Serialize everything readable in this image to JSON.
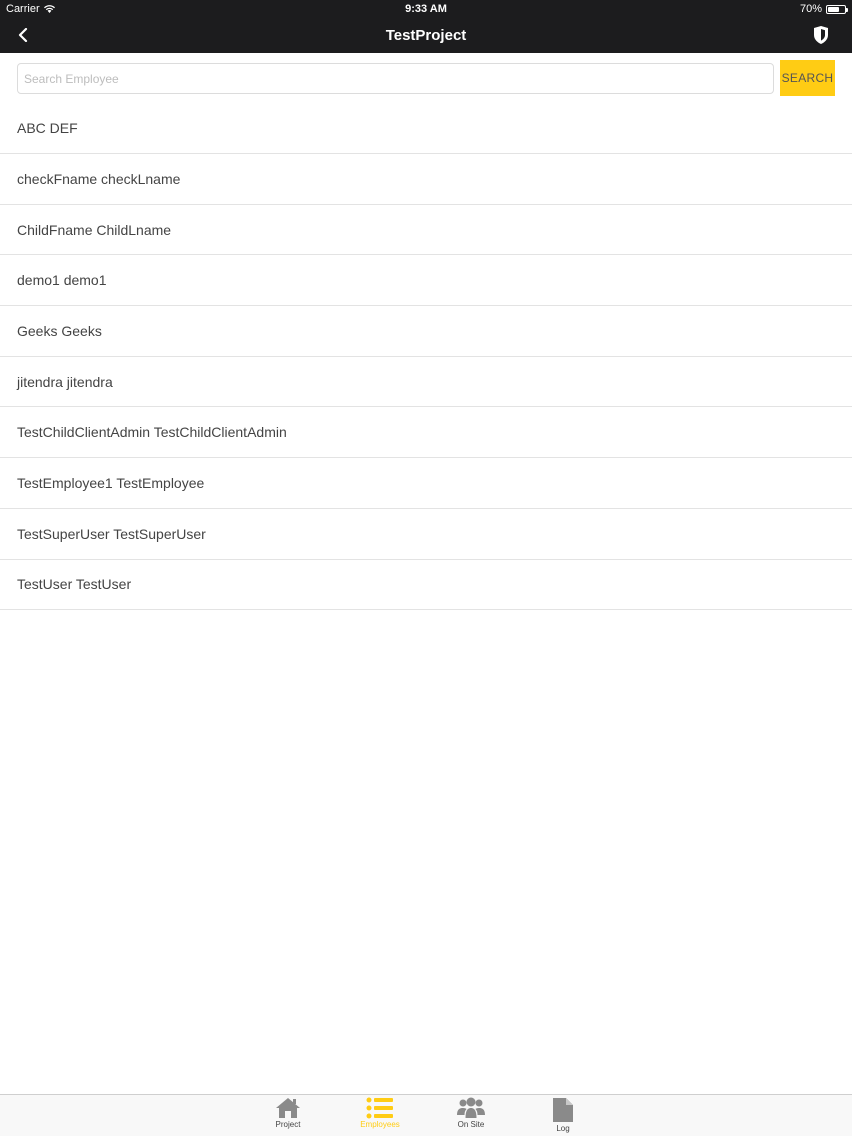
{
  "status_bar": {
    "carrier": "Carrier",
    "time": "9:33 AM",
    "battery_text": "70%",
    "battery_level": 0.7
  },
  "nav": {
    "title": "TestProject",
    "back_icon": "chevron-left-icon",
    "right_icon": "shield-icon"
  },
  "search": {
    "placeholder": "Search Employee",
    "value": "",
    "button_label": "SEARCH"
  },
  "employees": [
    "ABC DEF",
    "checkFname checkLname",
    "ChildFname ChildLname",
    "demo1 demo1",
    "Geeks Geeks",
    "jitendra jitendra",
    "TestChildClientAdmin TestChildClientAdmin",
    "TestEmployee1 TestEmployee",
    "TestSuperUser TestSuperUser",
    "TestUser TestUser"
  ],
  "tabs": [
    {
      "label": "Project",
      "icon": "home-icon"
    },
    {
      "label": "Employees",
      "icon": "list-icon",
      "active": true
    },
    {
      "label": "On Site",
      "icon": "users-icon"
    },
    {
      "label": "Log",
      "icon": "document-icon"
    }
  ],
  "colors": {
    "accent": "#ffcc14",
    "header": "#1c1c1e",
    "text": "#444444",
    "tab_icon": "#8a8a8a"
  }
}
